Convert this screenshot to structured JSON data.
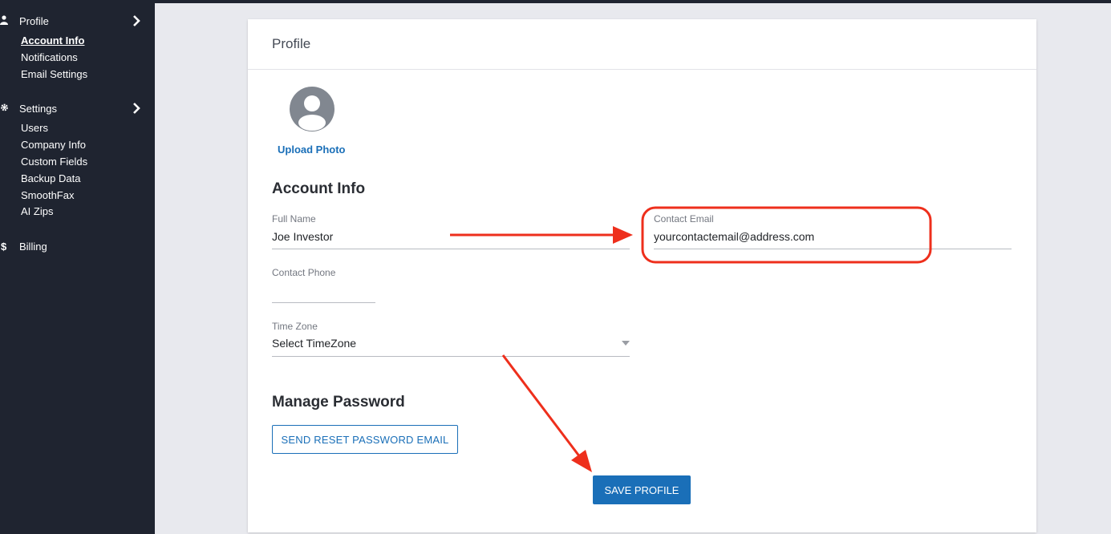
{
  "sidebar": {
    "profile": {
      "label": "Profile",
      "icon": "user-icon",
      "items": [
        "Account Info",
        "Notifications",
        "Email Settings"
      ]
    },
    "settings": {
      "label": "Settings",
      "icon": "gear-icon",
      "items": [
        "Users",
        "Company Info",
        "Custom Fields",
        "Backup Data",
        "SmoothFax",
        "AI Zips"
      ]
    },
    "billing": {
      "label": "Billing",
      "icon": "dollar-icon"
    },
    "active_item": "Account Info"
  },
  "main": {
    "card_title": "Profile",
    "upload_photo_label": "Upload Photo",
    "account_info_heading": "Account Info",
    "fields": {
      "full_name": {
        "label": "Full Name",
        "value": "Joe Investor"
      },
      "contact_email": {
        "label": "Contact Email",
        "value": "yourcontactemail@address.com"
      },
      "contact_phone": {
        "label": "Contact Phone",
        "value": ""
      },
      "time_zone": {
        "label": "Time Zone",
        "value": "Select TimeZone"
      }
    },
    "manage_password_heading": "Manage Password",
    "reset_password_button": "SEND RESET PASSWORD EMAIL",
    "save_button": "SAVE PROFILE"
  },
  "colors": {
    "sidebar_bg": "#1f2430",
    "page_bg": "#e8e9ee",
    "accent": "#1a6fb8",
    "annotation_red": "#ee2f1c"
  }
}
